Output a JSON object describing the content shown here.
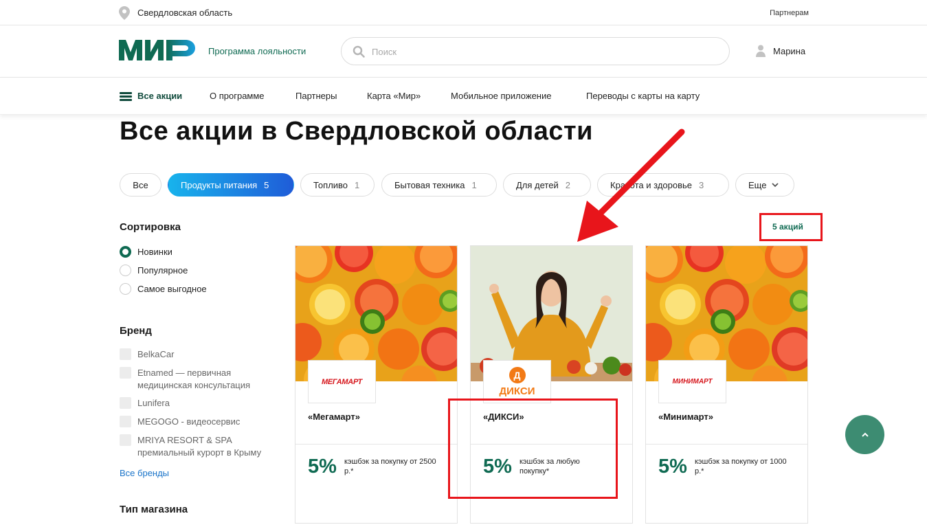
{
  "topbar": {
    "region": "Свердловская область",
    "partners": "Партнерам"
  },
  "header": {
    "loyalty": "Программа лояльности",
    "search_placeholder": "Поиск",
    "user_name": "Марина"
  },
  "nav": {
    "items": [
      "Все акции",
      "О программе",
      "Партнеры",
      "Карта «Мир»",
      "Мобильное приложение",
      "Переводы с карты на карту"
    ]
  },
  "page_title": "Все акции в Свердловской области",
  "filters": [
    {
      "label": "Все",
      "count": ""
    },
    {
      "label": "Продукты питания",
      "count": "5",
      "active": true
    },
    {
      "label": "Топливо",
      "count": "1"
    },
    {
      "label": "Бытовая техника",
      "count": "1"
    },
    {
      "label": "Для детей",
      "count": "2"
    },
    {
      "label": "Красота и здоровье",
      "count": "3"
    },
    {
      "label": "Еще",
      "count": ""
    }
  ],
  "sort": {
    "title": "Сортировка",
    "options": [
      "Новинки",
      "Популярное",
      "Самое выгодное"
    ],
    "selected": "Новинки"
  },
  "brand": {
    "title": "Бренд",
    "items": [
      "BelkaCar",
      "Etnamed — первичная медицинская консультация",
      "Lunifera",
      "MEGOGO - видеосервис",
      "MRIYA RESORT & SPA премиальный курорт в Крыму"
    ],
    "all_link": "Все бренды"
  },
  "shop_type": {
    "title": "Тип магазина"
  },
  "offers_count": "5 акций",
  "cards": [
    {
      "name": "«Мегамарт»",
      "logo": "МЕГАМАРТ",
      "percent": "5%",
      "desc": "кэшбэк за покупку от 2500 р.*"
    },
    {
      "name": "«ДИКСИ»",
      "logo": "ДИКСИ",
      "logo_badge": "Д",
      "percent": "5%",
      "desc": "кэшбэк за любую покупку*"
    },
    {
      "name": "«Минимарт»",
      "logo": "МИНИМАРТ",
      "percent": "5%",
      "desc": "кэшбэк за покупку от 1000 р.*"
    }
  ],
  "colors": {
    "brand_green": "#0f6a52",
    "accent_blue": "#1f5cd8",
    "highlight_red": "#e8151b"
  },
  "icons": {
    "location": "location-pin-icon",
    "search": "search-icon",
    "user": "user-icon",
    "menu": "hamburger-icon",
    "scroll_top": "chevron-up-icon"
  }
}
